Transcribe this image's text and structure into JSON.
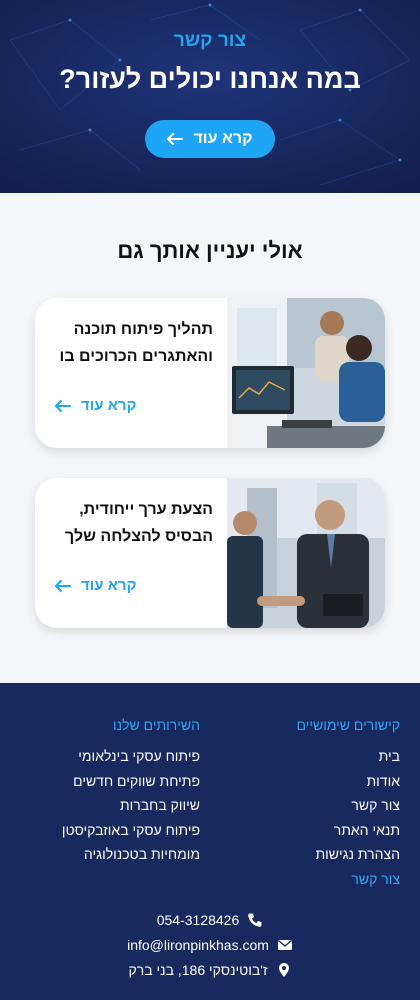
{
  "hero": {
    "kicker": "צור קשר",
    "title": "במה אנחנו יכולים לעזור?",
    "button_label": "קרא עוד"
  },
  "related": {
    "title": "אולי יעניין אותך גם",
    "cards": [
      {
        "title": "תהליך פיתוח תוכנה והאתגרים הכרוכים בו",
        "link_label": "קרא עוד"
      },
      {
        "title": "הצעת ערך ייחודית, הבסיס להצלחה שלך",
        "link_label": "קרא עוד"
      }
    ]
  },
  "footer": {
    "useful_links": {
      "heading": "קישורים שימושיים",
      "items": [
        "בית",
        "אודות",
        "צור קשר",
        "תנאי האתר",
        "הצהרת נגישות"
      ]
    },
    "services": {
      "heading": "השירותים שלנו",
      "items": [
        "פיתוח עסקי בינלאומי",
        "פתיחת שווקים חדשים",
        "שיווק בחברות",
        "פיתוח עסקי באוזבקיסטן",
        "מומחיות בטכנולוגיה"
      ]
    },
    "contact": {
      "heading": "צור קשר",
      "phone": "054-3128426",
      "email": "info@lironpinkhas.com",
      "address": "ז'בוטינסקי 186, בני ברק"
    }
  },
  "colors": {
    "navy": "#16245a",
    "accent": "#1ea5f3",
    "footer_bg": "#17295e"
  },
  "icons": [
    "arrow-left-icon",
    "phone-icon",
    "email-icon",
    "location-pin-icon"
  ]
}
